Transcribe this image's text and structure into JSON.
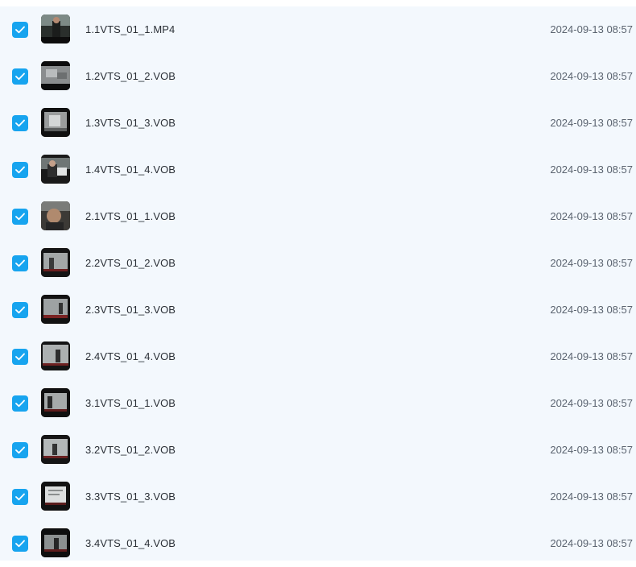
{
  "files": [
    {
      "name": "1.1VTS_01_1.MP4",
      "date": "2024-09-13 08:57",
      "checked": true,
      "thumb_icon": "video-thumbnail-icon"
    },
    {
      "name": "1.2VTS_01_2.VOB",
      "date": "2024-09-13 08:57",
      "checked": true,
      "thumb_icon": "video-thumbnail-icon"
    },
    {
      "name": "1.3VTS_01_3.VOB",
      "date": "2024-09-13 08:57",
      "checked": true,
      "thumb_icon": "video-thumbnail-icon"
    },
    {
      "name": "1.4VTS_01_4.VOB",
      "date": "2024-09-13 08:57",
      "checked": true,
      "thumb_icon": "video-thumbnail-icon"
    },
    {
      "name": "2.1VTS_01_1.VOB",
      "date": "2024-09-13 08:57",
      "checked": true,
      "thumb_icon": "video-thumbnail-icon"
    },
    {
      "name": "2.2VTS_01_2.VOB",
      "date": "2024-09-13 08:57",
      "checked": true,
      "thumb_icon": "video-thumbnail-icon"
    },
    {
      "name": "2.3VTS_01_3.VOB",
      "date": "2024-09-13 08:57",
      "checked": true,
      "thumb_icon": "video-thumbnail-icon"
    },
    {
      "name": "2.4VTS_01_4.VOB",
      "date": "2024-09-13 08:57",
      "checked": true,
      "thumb_icon": "video-thumbnail-icon"
    },
    {
      "name": "3.1VTS_01_1.VOB",
      "date": "2024-09-13 08:57",
      "checked": true,
      "thumb_icon": "video-thumbnail-icon"
    },
    {
      "name": "3.2VTS_01_2.VOB",
      "date": "2024-09-13 08:57",
      "checked": true,
      "thumb_icon": "video-thumbnail-icon"
    },
    {
      "name": "3.3VTS_01_3.VOB",
      "date": "2024-09-13 08:57",
      "checked": true,
      "thumb_icon": "video-thumbnail-icon"
    },
    {
      "name": "3.4VTS_01_4.VOB",
      "date": "2024-09-13 08:57",
      "checked": true,
      "thumb_icon": "video-thumbnail-icon"
    }
  ],
  "colors": {
    "checkbox": "#17a4ef",
    "list_background": "#f3f8fd",
    "filename_text": "#2a2f36",
    "date_text": "#5b6470"
  }
}
